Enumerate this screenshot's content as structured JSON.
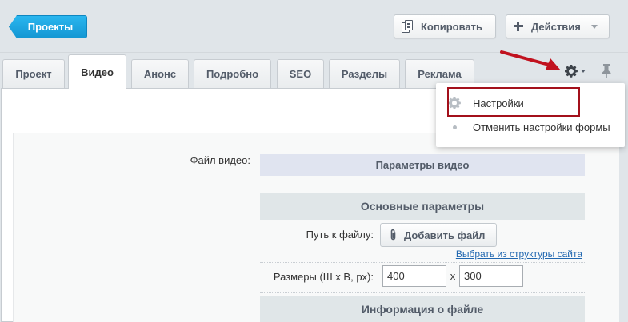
{
  "toolbar": {
    "back_label": "Проекты",
    "copy_label": "Копировать",
    "actions_label": "Действия"
  },
  "tabs": [
    {
      "label": "Проект",
      "active": false
    },
    {
      "label": "Видео",
      "active": true
    },
    {
      "label": "Анонс",
      "active": false
    },
    {
      "label": "Подробно",
      "active": false
    },
    {
      "label": "SEO",
      "active": false
    },
    {
      "label": "Разделы",
      "active": false
    },
    {
      "label": "Реклама",
      "active": false
    }
  ],
  "menu": {
    "items": [
      {
        "label": "Настройки",
        "icon": "gear-icon"
      },
      {
        "label": "Отменить настройки формы",
        "icon": "bullet-icon"
      }
    ]
  },
  "form": {
    "file_label": "Файл видео:",
    "params_header": "Параметры видео",
    "basic_header": "Основные параметры",
    "path_label": "Путь к файлу:",
    "add_file_label": "Добавить файл",
    "structure_link": "Выбрать из структуры сайта",
    "size_label": "Размеры (Ш х В, px):",
    "width_value": "400",
    "size_separator": "x",
    "height_value": "300",
    "info_header": "Информация о файле"
  },
  "colors": {
    "accent": "#1aa6e0",
    "highlight": "#a3101b",
    "link": "#2067b0"
  }
}
